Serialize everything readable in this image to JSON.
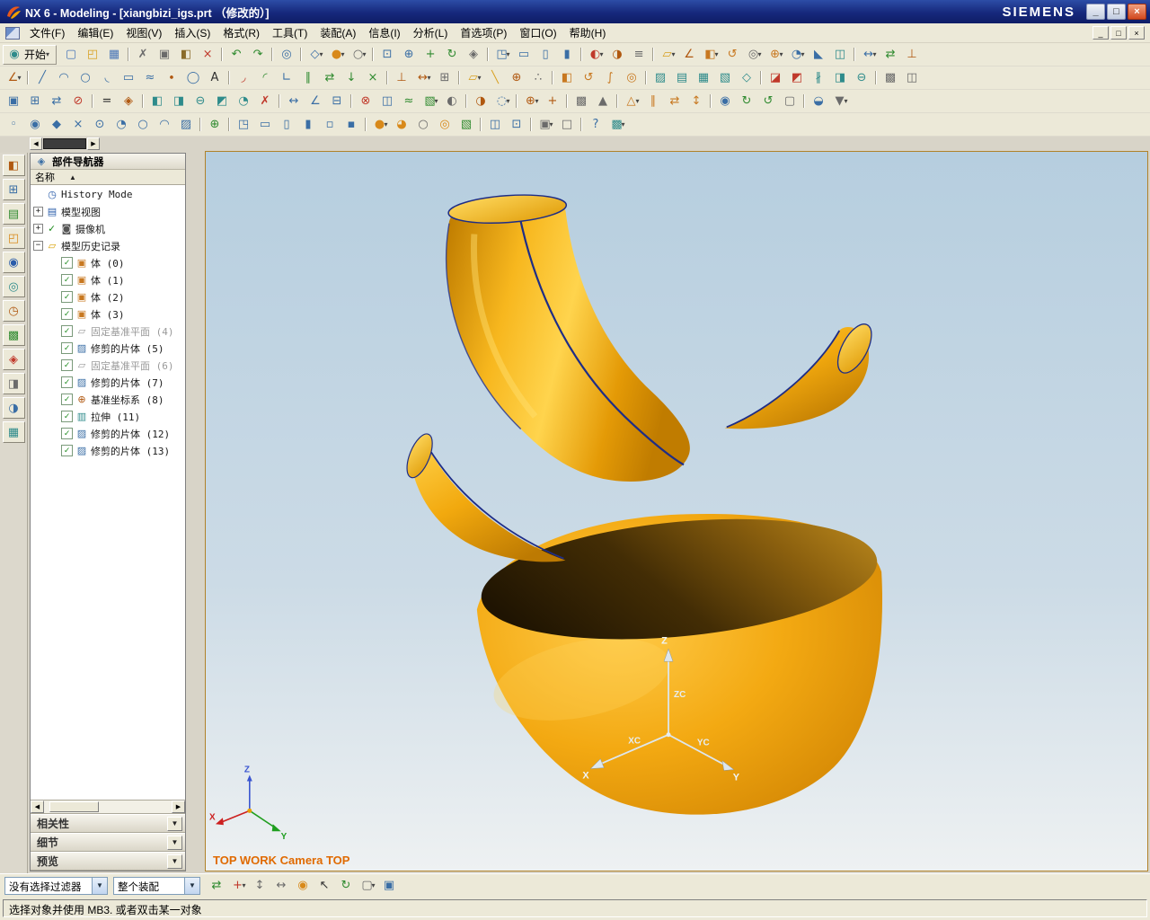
{
  "title_bar": {
    "title": "NX 6 - Modeling - [xiangbizi_igs.prt （修改的）]",
    "brand": "SIEMENS",
    "minimize_glyph": "_",
    "maximize_glyph": "□",
    "close_glyph": "×"
  },
  "menu_bar": {
    "items": [
      "文件(F)",
      "编辑(E)",
      "视图(V)",
      "插入(S)",
      "格式(R)",
      "工具(T)",
      "装配(A)",
      "信息(I)",
      "分析(L)",
      "首选项(P)",
      "窗口(O)",
      "帮助(H)"
    ],
    "minimize_glyph": "_",
    "restore_glyph": "□",
    "close_glyph": "×"
  },
  "toolbars": {
    "start_label": "开始",
    "start_glyph": "◉",
    "caret": "▾",
    "row1": [
      [
        "new-icon",
        "▢",
        "#4a76b8"
      ],
      [
        "open-icon",
        "◰",
        "#d8a020"
      ],
      [
        "save-icon",
        "▦",
        "#4a76b8"
      ],
      [
        "toolbar-separator",
        "",
        ""
      ],
      [
        "cut-icon",
        "✗",
        "#6b6b6b"
      ],
      [
        "copy-icon",
        "▣",
        "#6b6b6b"
      ],
      [
        "paste-icon",
        "◧",
        "#8a6b2a"
      ],
      [
        "delete-icon",
        "×",
        "#c0392b"
      ],
      [
        "toolbar-separator",
        "",
        ""
      ],
      [
        "undo-icon",
        "↶",
        "#2f8a2f"
      ],
      [
        "redo-icon",
        "↷",
        "#2f8a2f"
      ],
      [
        "toolbar-separator",
        "",
        ""
      ],
      [
        "command-finder-icon",
        "◎",
        "#3a6ea5"
      ],
      [
        "toolbar-separator",
        "",
        ""
      ],
      [
        "orient-view-icon",
        "◇",
        "#3a6ea5",
        1
      ],
      [
        "rendering-style-icon",
        "●",
        "#d8891a",
        1
      ],
      [
        "wireframe-style-icon",
        "○",
        "#6b6b6b",
        1
      ],
      [
        "toolbar-separator",
        "",
        ""
      ],
      [
        "fit-view-icon",
        "⊡",
        "#3a6ea5"
      ],
      [
        "zoom-icon",
        "⊕",
        "#3a6ea5"
      ],
      [
        "pan-icon",
        "+",
        "#2f8a2f"
      ],
      [
        "rotate-view-icon",
        "↻",
        "#2f8a2f"
      ],
      [
        "perspective-icon",
        "◈",
        "#6b6b6b"
      ],
      [
        "toolbar-separator",
        "",
        ""
      ],
      [
        "trimetric-view-icon",
        "◳",
        "#3a6ea5",
        1
      ],
      [
        "top-view-icon",
        "▭",
        "#3a6ea5"
      ],
      [
        "front-view-icon",
        "▯",
        "#3a6ea5"
      ],
      [
        "right-view-icon",
        "▮",
        "#3a6ea5"
      ],
      [
        "toolbar-separator",
        "",
        ""
      ],
      [
        "show-hide-icon",
        "◐",
        "#c0392b",
        1
      ],
      [
        "immediate-hide-icon",
        "◑",
        "#b05810"
      ],
      [
        "layer-settings-icon",
        "≡",
        "#6b6b6b"
      ],
      [
        "toolbar-separator",
        "",
        ""
      ],
      [
        "datum-plane-icon",
        "▱",
        "#d8a020",
        1
      ],
      [
        "sketch-icon",
        "∠",
        "#b05810"
      ],
      [
        "extrude-icon",
        "◧",
        "#c87820",
        1
      ],
      [
        "revolve-icon",
        "↺",
        "#c87820"
      ],
      [
        "hole-icon",
        "◎",
        "#6b6b6b",
        1
      ],
      [
        "unite-icon",
        "⊕",
        "#c87820",
        1
      ],
      [
        "edge-blend-icon",
        "◔",
        "#3a6ea5",
        1
      ],
      [
        "chamfer-icon",
        "◣",
        "#3a6ea5"
      ],
      [
        "shell-icon",
        "◫",
        "#2e8b8b"
      ],
      [
        "toolbar-separator",
        "",
        ""
      ],
      [
        "measure-distance-icon",
        "↔",
        "#3a6ea5",
        1
      ],
      [
        "move-component-icon",
        "⇄",
        "#2f8a2f"
      ],
      [
        "assembly-constraints-icon",
        "⊥",
        "#b05810"
      ]
    ],
    "row2": [
      [
        "direct-sketch-icon",
        "∠",
        "#b05810",
        1
      ],
      [
        "toolbar-separator",
        "",
        ""
      ],
      [
        "line-icon",
        "╱",
        "#3a6ea5"
      ],
      [
        "arc-icon",
        "◠",
        "#3a6ea5"
      ],
      [
        "circle-icon",
        "○",
        "#3a6ea5"
      ],
      [
        "fillet-icon",
        "◟",
        "#3a6ea5"
      ],
      [
        "rectangle-icon",
        "▭",
        "#3a6ea5"
      ],
      [
        "studio-spline-icon",
        "≈",
        "#3a6ea5"
      ],
      [
        "point-icon",
        "∙",
        "#b05810"
      ],
      [
        "ellipse-icon",
        "◯",
        "#3a6ea5"
      ],
      [
        "text-icon",
        "A",
        "#2f2f2f"
      ],
      [
        "toolbar-separator",
        "",
        ""
      ],
      [
        "quick-trim-icon",
        "◞",
        "#c0392b"
      ],
      [
        "quick-extend-icon",
        "◜",
        "#2f8a2f"
      ],
      [
        "make-corner-icon",
        "∟",
        "#3a6ea5"
      ],
      [
        "offset-curve-icon",
        "∥",
        "#2f8a2f"
      ],
      [
        "mirror-curve-icon",
        "⇄",
        "#2f8a2f"
      ],
      [
        "project-curve-icon",
        "↓",
        "#2f8a2f"
      ],
      [
        "intersection-curve-icon",
        "×",
        "#2f8a2f"
      ],
      [
        "toolbar-separator",
        "",
        ""
      ],
      [
        "geometric-constraints-icon",
        "⊥",
        "#b05810"
      ],
      [
        "dimensions-icon",
        "↔",
        "#b05810",
        1
      ],
      [
        "auto-constrain-icon",
        "⊞",
        "#6b6b6b"
      ],
      [
        "toolbar-separator",
        "",
        ""
      ],
      [
        "datum-plane-icon",
        "▱",
        "#d8a020",
        1
      ],
      [
        "datum-axis-icon",
        "╲",
        "#d8a020"
      ],
      [
        "datum-csys-icon",
        "⊕",
        "#b05810"
      ],
      [
        "point-set-icon",
        "∴",
        "#6b6b6b"
      ],
      [
        "toolbar-separator",
        "",
        ""
      ],
      [
        "extrude-icon",
        "◧",
        "#c87820"
      ],
      [
        "revolve-icon",
        "↺",
        "#c87820"
      ],
      [
        "sweep-icon",
        "∫",
        "#c87820"
      ],
      [
        "tube-icon",
        "◎",
        "#c87820"
      ],
      [
        "toolbar-separator",
        "",
        ""
      ],
      [
        "ruled-surface-icon",
        "▨",
        "#2e8b8b"
      ],
      [
        "through-curves-icon",
        "▤",
        "#2e8b8b"
      ],
      [
        "curve-mesh-icon",
        "▦",
        "#2e8b8b"
      ],
      [
        "swept-icon",
        "▧",
        "#2e8b8b"
      ],
      [
        "n-sided-surface-icon",
        "◇",
        "#2e8b8b"
      ],
      [
        "toolbar-separator",
        "",
        ""
      ],
      [
        "trimmed-sheet-icon",
        "◪",
        "#c0392b"
      ],
      [
        "trim-body-icon",
        "◩",
        "#c0392b"
      ],
      [
        "sew-icon",
        "∦",
        "#2e8b8b"
      ],
      [
        "thicken-icon",
        "◨",
        "#2e8b8b"
      ],
      [
        "offset-surface-icon",
        "⊖",
        "#2e8b8b"
      ],
      [
        "toolbar-separator",
        "",
        ""
      ],
      [
        "pattern-feature-icon",
        "▩",
        "#6b6b6b"
      ],
      [
        "mirror-feature-icon",
        "◫",
        "#6b6b6b"
      ]
    ],
    "row3": [
      [
        "edit-feature-icon",
        "▣",
        "#3a6ea5"
      ],
      [
        "edit-positioning-icon",
        "⊞",
        "#3a6ea5"
      ],
      [
        "move-feature-icon",
        "⇄",
        "#3a6ea5"
      ],
      [
        "suppress-feature-icon",
        "⊘",
        "#c0392b"
      ],
      [
        "toolbar-separator",
        "",
        ""
      ],
      [
        "expression-icon",
        "=",
        "#2f2f2f"
      ],
      [
        "part-module-icon",
        "◈",
        "#b05810"
      ],
      [
        "toolbar-separator",
        "",
        ""
      ],
      [
        "move-face-icon",
        "◧",
        "#2e8b8b"
      ],
      [
        "pull-face-icon",
        "◨",
        "#2e8b8b"
      ],
      [
        "offset-region-icon",
        "⊖",
        "#2e8b8b"
      ],
      [
        "replace-face-icon",
        "◩",
        "#2e8b8b"
      ],
      [
        "resize-blend-icon",
        "◔",
        "#2e8b8b"
      ],
      [
        "delete-face-icon",
        "✗",
        "#c0392b"
      ],
      [
        "toolbar-separator",
        "",
        ""
      ],
      [
        "measure-distance-icon",
        "↔",
        "#3a6ea5"
      ],
      [
        "measure-angle-icon",
        "∠",
        "#3a6ea5"
      ],
      [
        "measure-body-icon",
        "⊟",
        "#3a6ea5"
      ],
      [
        "toolbar-separator",
        "",
        ""
      ],
      [
        "interference-check-icon",
        "⊗",
        "#c0392b"
      ],
      [
        "section-analysis-icon",
        "◫",
        "#3a6ea5"
      ],
      [
        "curve-analysis-icon",
        "≈",
        "#2f8a2f"
      ],
      [
        "surface-analysis-icon",
        "▧",
        "#2f8a2f",
        1
      ],
      [
        "reflection-analysis-icon",
        "◐",
        "#6b6b6b"
      ],
      [
        "toolbar-separator",
        "",
        ""
      ],
      [
        "edit-object-display-icon",
        "◑",
        "#b05810"
      ],
      [
        "show-and-hide-icon",
        "◌",
        "#3a6ea5",
        1
      ],
      [
        "toolbar-separator",
        "",
        ""
      ],
      [
        "wcs-dynamics-icon",
        "⊕",
        "#b05810",
        1
      ],
      [
        "wcs-orient-icon",
        "+",
        "#b05810"
      ],
      [
        "toolbar-separator",
        "",
        ""
      ],
      [
        "instance-geometry-icon",
        "▩",
        "#6b6b6b"
      ],
      [
        "promote-body-icon",
        "▲",
        "#6b6b6b"
      ],
      [
        "toolbar-separator",
        "",
        ""
      ],
      [
        "synchronous-modeling-icon",
        "△",
        "#c87820",
        1
      ],
      [
        "make-coplanar-icon",
        "∥",
        "#c87820"
      ],
      [
        "make-symmetric-icon",
        "⇄",
        "#c87820"
      ],
      [
        "linear-dimension-icon",
        "↕",
        "#c87820"
      ],
      [
        "toolbar-separator",
        "",
        ""
      ],
      [
        "object-display-icon",
        "◉",
        "#3a6ea5"
      ],
      [
        "refresh-icon",
        "↻",
        "#2f8a2f"
      ],
      [
        "update-display-icon",
        "↺",
        "#2f8a2f"
      ],
      [
        "snapshot-icon",
        "▢",
        "#6b6b6b"
      ],
      [
        "toolbar-separator",
        "",
        ""
      ],
      [
        "roles-icon",
        "◒",
        "#3a6ea5"
      ],
      [
        "customize-icon",
        "▼",
        "#6b6b6b",
        1
      ]
    ],
    "row4": [
      [
        "end-point-snap-icon",
        "◦",
        "#3a6ea5"
      ],
      [
        "mid-point-snap-icon",
        "◉",
        "#3a6ea5"
      ],
      [
        "control-point-snap-icon",
        "◆",
        "#3a6ea5"
      ],
      [
        "intersection-snap-icon",
        "×",
        "#3a6ea5"
      ],
      [
        "arc-center-snap-icon",
        "⊙",
        "#3a6ea5"
      ],
      [
        "quadrant-snap-icon",
        "◔",
        "#3a6ea5"
      ],
      [
        "existing-point-snap-icon",
        "○",
        "#3a6ea5"
      ],
      [
        "point-on-curve-snap-icon",
        "◠",
        "#3a6ea5"
      ],
      [
        "point-on-surface-snap-icon",
        "▨",
        "#3a6ea5"
      ],
      [
        "toolbar-separator",
        "",
        ""
      ],
      [
        "snap-point-toggle-icon",
        "⊕",
        "#2f8a2f"
      ],
      [
        "toolbar-separator",
        "",
        ""
      ],
      [
        "view-trimetric-icon",
        "◳",
        "#3a6ea5"
      ],
      [
        "view-top-icon",
        "▭",
        "#3a6ea5"
      ],
      [
        "view-front-icon",
        "▯",
        "#3a6ea5"
      ],
      [
        "view-right-icon",
        "▮",
        "#3a6ea5"
      ],
      [
        "view-back-icon",
        "▫",
        "#3a6ea5"
      ],
      [
        "view-bottom-icon",
        "▪",
        "#3a6ea5"
      ],
      [
        "toolbar-separator",
        "",
        ""
      ],
      [
        "shaded-with-edges-icon",
        "●",
        "#d8891a",
        1
      ],
      [
        "shaded-icon",
        "◕",
        "#d8891a"
      ],
      [
        "wireframe-icon",
        "○",
        "#6b6b6b"
      ],
      [
        "studio-render-icon",
        "◎",
        "#d8891a"
      ],
      [
        "face-analysis-icon",
        "▧",
        "#2f8a2f"
      ],
      [
        "toolbar-separator",
        "",
        ""
      ],
      [
        "clip-section-icon",
        "◫",
        "#3a6ea5"
      ],
      [
        "fit-window-icon",
        "⊡",
        "#3a6ea5"
      ],
      [
        "toolbar-separator",
        "",
        ""
      ],
      [
        "window-icon",
        "▣",
        "#6b6b6b",
        1
      ],
      [
        "full-screen-icon",
        "□",
        "#6b6b6b"
      ],
      [
        "toolbar-separator",
        "",
        ""
      ],
      [
        "context-help-icon",
        "?",
        "#3a6ea5"
      ],
      [
        "materials-icon",
        "▩",
        "#2e8b8b",
        1
      ]
    ]
  },
  "resource_rail": {
    "icons": [
      [
        "assembly-navigator-tab-icon",
        "◧",
        "#b05810"
      ],
      [
        "constraint-navigator-tab-icon",
        "⊞",
        "#3a6ea5"
      ],
      [
        "part-navigator-tab-icon",
        "▤",
        "#2f8a2f"
      ],
      [
        "reuse-library-tab-icon",
        "◰",
        "#d8891a"
      ],
      [
        "hd3d-tool-tab-icon",
        "◉",
        "#2a5caa"
      ],
      [
        "web-browser-tab-icon",
        "◎",
        "#2e8b8b"
      ],
      [
        "history-palette-tab-icon",
        "◷",
        "#b05810"
      ],
      [
        "system-materials-tab-icon",
        "▩",
        "#2f8a2f"
      ],
      [
        "process-studio-tab-icon",
        "◈",
        "#c0392b"
      ],
      [
        "manufacturing-wizards-tab-icon",
        "◨",
        "#6b6b6b"
      ],
      [
        "roles-tab-icon",
        "◑",
        "#3a6ea5"
      ],
      [
        "system-scenes-tab-icon",
        "▦",
        "#2e8b8b"
      ]
    ]
  },
  "navigator": {
    "title": "部件导航器",
    "title_glyph": "◈",
    "header": "名称",
    "sort_glyph": "▲",
    "arrow_left": "◀",
    "arrow_right": "▶",
    "chevron_glyph": "▼",
    "tree": [
      {
        "name": "tree-item-history-mode",
        "label": "History Mode",
        "glyph": "◷",
        "color": "#2a5caa",
        "exp": "",
        "cls": "ind1 noexp"
      },
      {
        "name": "tree-item-model-views",
        "label": "模型视图",
        "glyph": "▤",
        "color": "#2a5caa",
        "exp": "+",
        "cls": "ind1"
      },
      {
        "name": "tree-item-cameras",
        "label": "摄像机",
        "glyph": "◙",
        "color": "#555555",
        "exp": "+",
        "chk": "✓",
        "cls": "ind1 mark"
      },
      {
        "name": "tree-item-model-history",
        "label": "模型历史记录",
        "glyph": "▱",
        "color": "#d8a000",
        "exp": "−",
        "cls": "ind1"
      },
      {
        "name": "tree-item-body-0",
        "label": "体 (0)",
        "glyph": "▣",
        "color": "#c87820",
        "exp": "",
        "chk": "✓",
        "cls": "ind2 noexp"
      },
      {
        "name": "tree-item-body-1",
        "label": "体 (1)",
        "glyph": "▣",
        "color": "#c87820",
        "exp": "",
        "chk": "✓",
        "cls": "ind2 noexp"
      },
      {
        "name": "tree-item-body-2",
        "label": "体 (2)",
        "glyph": "▣",
        "color": "#c87820",
        "exp": "",
        "chk": "✓",
        "cls": "ind2 noexp"
      },
      {
        "name": "tree-item-body-3",
        "label": "体 (3)",
        "glyph": "▣",
        "color": "#c87820",
        "exp": "",
        "chk": "✓",
        "cls": "ind2 noexp"
      },
      {
        "name": "tree-item-fixed-datum-plane-4",
        "label": "固定基准平面 (4)",
        "glyph": "▱",
        "color": "#9a9a9a",
        "exp": "",
        "chk": "✓",
        "cls": "ind2 noexp gray"
      },
      {
        "name": "tree-item-trimmed-sheet-5",
        "label": "修剪的片体 (5)",
        "glyph": "▨",
        "color": "#3a6ea5",
        "exp": "",
        "chk": "✓",
        "cls": "ind2 noexp"
      },
      {
        "name": "tree-item-fixed-datum-plane-6",
        "label": "固定基准平面 (6)",
        "glyph": "▱",
        "color": "#9a9a9a",
        "exp": "",
        "chk": "✓",
        "cls": "ind2 noexp gray"
      },
      {
        "name": "tree-item-trimmed-sheet-7",
        "label": "修剪的片体 (7)",
        "glyph": "▨",
        "color": "#3a6ea5",
        "exp": "",
        "chk": "✓",
        "cls": "ind2 noexp"
      },
      {
        "name": "tree-item-datum-csys-8",
        "label": "基准坐标系 (8)",
        "glyph": "⊕",
        "color": "#b05810",
        "exp": "",
        "chk": "✓",
        "cls": "ind2 noexp"
      },
      {
        "name": "tree-item-extrude-11",
        "label": "拉伸 (11)",
        "glyph": "▥",
        "color": "#2e8b8b",
        "exp": "",
        "chk": "✓",
        "cls": "ind2 noexp"
      },
      {
        "name": "tree-item-trimmed-sheet-12",
        "label": "修剪的片体 (12)",
        "glyph": "▨",
        "color": "#3a6ea5",
        "exp": "",
        "chk": "✓",
        "cls": "ind2 noexp"
      },
      {
        "name": "tree-item-trimmed-sheet-13",
        "label": "修剪的片体 (13)",
        "glyph": "▨",
        "color": "#3a6ea5",
        "exp": "",
        "chk": "✓",
        "cls": "ind2 noexp"
      }
    ],
    "sections": [
      {
        "name": "section-dependencies",
        "label": "相关性"
      },
      {
        "name": "section-details",
        "label": "细节"
      },
      {
        "name": "section-preview",
        "label": "预览"
      }
    ]
  },
  "viewport": {
    "view_label": "TOP WORK Camera TOP",
    "triad": {
      "z": "Z",
      "zc": "ZC",
      "xc": "XC",
      "x": "X",
      "yc": "YC",
      "y": "Y"
    },
    "wcs": {
      "x": "X",
      "y": "Y",
      "z": "Z"
    }
  },
  "sel_bar": {
    "filter_value": "没有选择过滤器",
    "scope_value": "整个装配",
    "combo_caret": "▼",
    "icons": [
      [
        "interpart-link-icon",
        "⇄",
        "#2f8a2f"
      ],
      [
        "snap-point-icon",
        "+",
        "#c0392b",
        1
      ],
      [
        "hand-tool-icon",
        "↕",
        "#6b6b6b"
      ],
      [
        "pan-tool-icon",
        "↔",
        "#6b6b6b"
      ],
      [
        "selection-ball-icon",
        "◉",
        "#d8891a"
      ],
      [
        "cursor-select-icon",
        "↖",
        "#2f2f2f"
      ],
      [
        "orbit-tool-icon",
        "↻",
        "#2f8a2f"
      ],
      [
        "rect-select-icon",
        "▢",
        "#6b6b6b",
        1
      ],
      [
        "work-part-icon",
        "▣",
        "#3a6ea5"
      ]
    ]
  },
  "status_bar": {
    "message": "选择对象并使用 MB3. 或者双击某一对象"
  }
}
